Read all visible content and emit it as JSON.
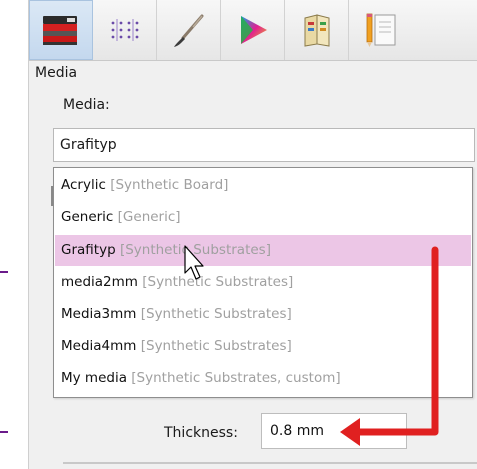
{
  "toolbar": {
    "tools": [
      {
        "icon": "media-stack-icon"
      },
      {
        "icon": "grid-dots-icon"
      },
      {
        "icon": "brush-icon"
      },
      {
        "icon": "color-triangle-icon"
      },
      {
        "icon": "book-icon"
      },
      {
        "icon": "pencil-document-icon"
      }
    ]
  },
  "section": {
    "title": "Media"
  },
  "media": {
    "label": "Media:",
    "value": "Grafityp"
  },
  "dropdown": {
    "items": [
      {
        "name": "Acrylic",
        "category": "[Synthetic Board]",
        "selected": false
      },
      {
        "name": "Generic",
        "category": "[Generic]",
        "selected": false
      },
      {
        "name": "Grafityp",
        "category": "[Synthetic Substrates]",
        "selected": true
      },
      {
        "name": "media2mm",
        "category": "[Synthetic Substrates]",
        "selected": false
      },
      {
        "name": "Media3mm",
        "category": "[Synthetic Substrates]",
        "selected": false
      },
      {
        "name": "Media4mm",
        "category": "[Synthetic Substrates]",
        "selected": false
      },
      {
        "name": "My media",
        "category": "[Synthetic Substrates, custom]",
        "selected": false
      }
    ]
  },
  "thickness": {
    "label": "Thickness:",
    "value": "0.8 mm"
  },
  "colors": {
    "selected_row": "#ecc6e6",
    "category_text": "#a0a0a0",
    "annotation_arrow": "#e02020",
    "guide_line": "#6a1b8a"
  }
}
